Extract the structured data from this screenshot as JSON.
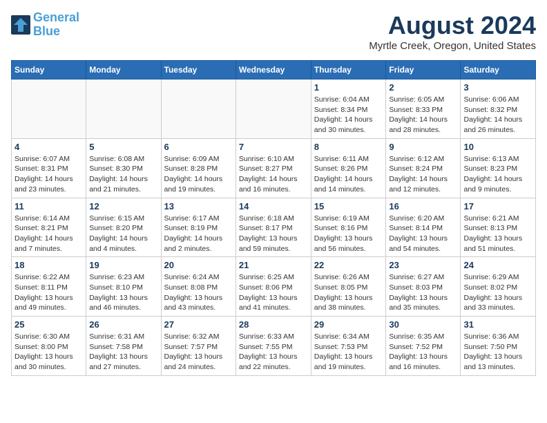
{
  "header": {
    "logo_line1": "General",
    "logo_line2": "Blue",
    "month_year": "August 2024",
    "location": "Myrtle Creek, Oregon, United States"
  },
  "weekdays": [
    "Sunday",
    "Monday",
    "Tuesday",
    "Wednesday",
    "Thursday",
    "Friday",
    "Saturday"
  ],
  "weeks": [
    [
      {
        "day": "",
        "info": ""
      },
      {
        "day": "",
        "info": ""
      },
      {
        "day": "",
        "info": ""
      },
      {
        "day": "",
        "info": ""
      },
      {
        "day": "1",
        "info": "Sunrise: 6:04 AM\nSunset: 8:34 PM\nDaylight: 14 hours\nand 30 minutes."
      },
      {
        "day": "2",
        "info": "Sunrise: 6:05 AM\nSunset: 8:33 PM\nDaylight: 14 hours\nand 28 minutes."
      },
      {
        "day": "3",
        "info": "Sunrise: 6:06 AM\nSunset: 8:32 PM\nDaylight: 14 hours\nand 26 minutes."
      }
    ],
    [
      {
        "day": "4",
        "info": "Sunrise: 6:07 AM\nSunset: 8:31 PM\nDaylight: 14 hours\nand 23 minutes."
      },
      {
        "day": "5",
        "info": "Sunrise: 6:08 AM\nSunset: 8:30 PM\nDaylight: 14 hours\nand 21 minutes."
      },
      {
        "day": "6",
        "info": "Sunrise: 6:09 AM\nSunset: 8:28 PM\nDaylight: 14 hours\nand 19 minutes."
      },
      {
        "day": "7",
        "info": "Sunrise: 6:10 AM\nSunset: 8:27 PM\nDaylight: 14 hours\nand 16 minutes."
      },
      {
        "day": "8",
        "info": "Sunrise: 6:11 AM\nSunset: 8:26 PM\nDaylight: 14 hours\nand 14 minutes."
      },
      {
        "day": "9",
        "info": "Sunrise: 6:12 AM\nSunset: 8:24 PM\nDaylight: 14 hours\nand 12 minutes."
      },
      {
        "day": "10",
        "info": "Sunrise: 6:13 AM\nSunset: 8:23 PM\nDaylight: 14 hours\nand 9 minutes."
      }
    ],
    [
      {
        "day": "11",
        "info": "Sunrise: 6:14 AM\nSunset: 8:21 PM\nDaylight: 14 hours\nand 7 minutes."
      },
      {
        "day": "12",
        "info": "Sunrise: 6:15 AM\nSunset: 8:20 PM\nDaylight: 14 hours\nand 4 minutes."
      },
      {
        "day": "13",
        "info": "Sunrise: 6:17 AM\nSunset: 8:19 PM\nDaylight: 14 hours\nand 2 minutes."
      },
      {
        "day": "14",
        "info": "Sunrise: 6:18 AM\nSunset: 8:17 PM\nDaylight: 13 hours\nand 59 minutes."
      },
      {
        "day": "15",
        "info": "Sunrise: 6:19 AM\nSunset: 8:16 PM\nDaylight: 13 hours\nand 56 minutes."
      },
      {
        "day": "16",
        "info": "Sunrise: 6:20 AM\nSunset: 8:14 PM\nDaylight: 13 hours\nand 54 minutes."
      },
      {
        "day": "17",
        "info": "Sunrise: 6:21 AM\nSunset: 8:13 PM\nDaylight: 13 hours\nand 51 minutes."
      }
    ],
    [
      {
        "day": "18",
        "info": "Sunrise: 6:22 AM\nSunset: 8:11 PM\nDaylight: 13 hours\nand 49 minutes."
      },
      {
        "day": "19",
        "info": "Sunrise: 6:23 AM\nSunset: 8:10 PM\nDaylight: 13 hours\nand 46 minutes."
      },
      {
        "day": "20",
        "info": "Sunrise: 6:24 AM\nSunset: 8:08 PM\nDaylight: 13 hours\nand 43 minutes."
      },
      {
        "day": "21",
        "info": "Sunrise: 6:25 AM\nSunset: 8:06 PM\nDaylight: 13 hours\nand 41 minutes."
      },
      {
        "day": "22",
        "info": "Sunrise: 6:26 AM\nSunset: 8:05 PM\nDaylight: 13 hours\nand 38 minutes."
      },
      {
        "day": "23",
        "info": "Sunrise: 6:27 AM\nSunset: 8:03 PM\nDaylight: 13 hours\nand 35 minutes."
      },
      {
        "day": "24",
        "info": "Sunrise: 6:29 AM\nSunset: 8:02 PM\nDaylight: 13 hours\nand 33 minutes."
      }
    ],
    [
      {
        "day": "25",
        "info": "Sunrise: 6:30 AM\nSunset: 8:00 PM\nDaylight: 13 hours\nand 30 minutes."
      },
      {
        "day": "26",
        "info": "Sunrise: 6:31 AM\nSunset: 7:58 PM\nDaylight: 13 hours\nand 27 minutes."
      },
      {
        "day": "27",
        "info": "Sunrise: 6:32 AM\nSunset: 7:57 PM\nDaylight: 13 hours\nand 24 minutes."
      },
      {
        "day": "28",
        "info": "Sunrise: 6:33 AM\nSunset: 7:55 PM\nDaylight: 13 hours\nand 22 minutes."
      },
      {
        "day": "29",
        "info": "Sunrise: 6:34 AM\nSunset: 7:53 PM\nDaylight: 13 hours\nand 19 minutes."
      },
      {
        "day": "30",
        "info": "Sunrise: 6:35 AM\nSunset: 7:52 PM\nDaylight: 13 hours\nand 16 minutes."
      },
      {
        "day": "31",
        "info": "Sunrise: 6:36 AM\nSunset: 7:50 PM\nDaylight: 13 hours\nand 13 minutes."
      }
    ]
  ]
}
